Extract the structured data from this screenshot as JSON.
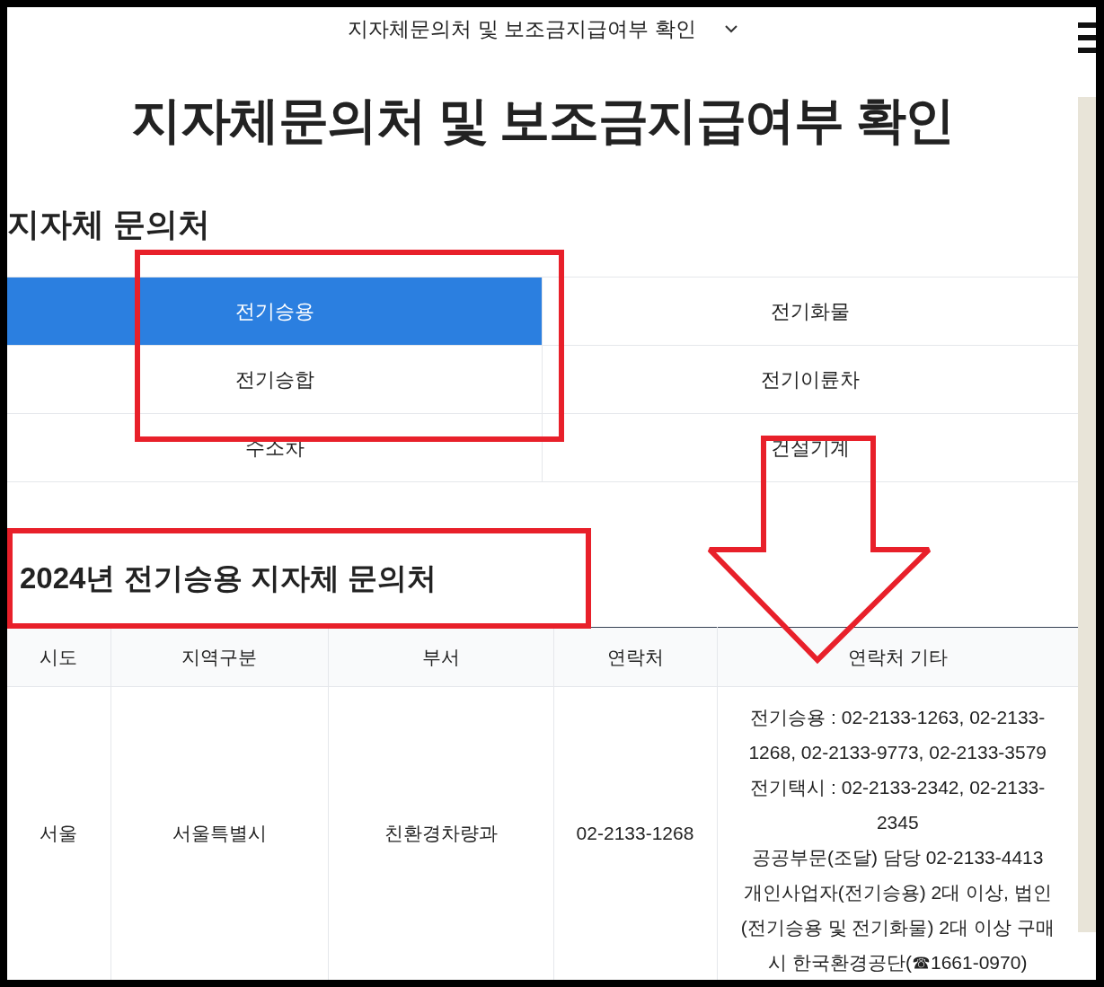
{
  "top_bar": {
    "title": "지자체문의처 및 보조금지급여부 확인"
  },
  "page_title": "지자체문의처 및 보조금지급여부 확인",
  "section_title": "지자체 문의처",
  "categories": [
    {
      "label": "전기승용",
      "selected": true
    },
    {
      "label": "전기화물",
      "selected": false
    },
    {
      "label": "전기승합",
      "selected": false
    },
    {
      "label": "전기이륜차",
      "selected": false
    },
    {
      "label": "수소차",
      "selected": false
    },
    {
      "label": "건설기계",
      "selected": false
    }
  ],
  "table_title": "2024년 전기승용 지자체 문의처",
  "table": {
    "columns": [
      "시도",
      "지역구분",
      "부서",
      "연락처",
      "연락처 기타"
    ],
    "rows": [
      {
        "cells": [
          "서울",
          "서울특별시",
          "친환경차량과",
          "02-2133-1268"
        ],
        "notes": [
          "전기승용 : 02-2133-1263, 02-2133-1268, 02-2133-9773, 02-2133-3579",
          "전기택시 : 02-2133-2342, 02-2133-2345",
          "공공부문(조달) 담당 02-2133-4413",
          "개인사업자(전기승용) 2대 이상, 법인(전기승용 및 전기화물) 2대 이상 구매 시 한국환경공단(☎1661-0970)"
        ]
      }
    ]
  }
}
